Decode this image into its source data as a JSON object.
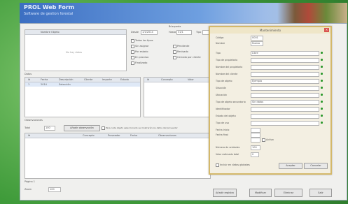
{
  "app": {
    "title": "PROL Web Form",
    "subtitle": "Software de gestion forestal"
  },
  "toolbar": {
    "search_title": "Búsqueda",
    "from_label": "Desde",
    "from_value": "1/1/2014",
    "to_label": "Hasta",
    "to_value": "31/1",
    "tipo_label": "Tipo"
  },
  "filters": {
    "options": [
      "Todos los tipos",
      "Sin asignar",
      "Por estado",
      "En proceso",
      "Finalizado"
    ],
    "options_right": [
      "Pendiente",
      "Revisado",
      "Cerrado por cliente"
    ]
  },
  "upper_list": {
    "header": "Nombre Objeto",
    "empty_text": "No hay datos"
  },
  "middle_tables": {
    "left_header": "Datos",
    "left_columns": [
      "Id",
      "Fecha",
      "Descripción",
      "Cliente",
      "Importe",
      "Estado"
    ],
    "right_columns": [
      "Id",
      "Concepto",
      "Valor"
    ],
    "left_row": [
      "1",
      "2014",
      "Selección",
      "",
      "",
      ""
    ]
  },
  "lower_section": {
    "label": "Observaciones",
    "count_label": "Total",
    "count_value": "100",
    "button_label": "Añadir observación",
    "hint": "Para cada objeto seleccionado se mostrarán los datos del proveedor",
    "columns": [
      "Id",
      "Concepto",
      "Proveedor",
      "Fecha",
      "Observaciones"
    ]
  },
  "status": {
    "left_label": "Página 1",
    "zoom_label": "Zoom",
    "zoom_value": "100"
  },
  "dialog": {
    "title": "Mantenimiento",
    "rows": [
      {
        "label": "Código",
        "value": "0001"
      },
      {
        "label": "Nombre",
        "value": "Nuevo"
      },
      {
        "label": "Tipo",
        "value": "Libre"
      },
      {
        "label": "Tipo de propietario",
        "value": ""
      },
      {
        "label": "Nombre del propietario",
        "value": ""
      },
      {
        "label": "Nombre del cliente",
        "value": ""
      },
      {
        "label": "Tipo de objeto",
        "value": "Ejemplo"
      },
      {
        "label": "Situación",
        "value": ""
      },
      {
        "label": "Ubicación",
        "value": ""
      },
      {
        "label": "Tipo de objeto secundario",
        "value": "Sin datos"
      },
      {
        "label": "Identificador",
        "value": ""
      },
      {
        "label": "Estado del objeto",
        "value": ""
      },
      {
        "label": "Tipo de uso",
        "value": ""
      },
      {
        "label": "Fecha inicio",
        "value": ""
      },
      {
        "label": "Fecha final",
        "value": ""
      }
    ],
    "extra_label": "Duración",
    "check_label": "Activo",
    "number_label": "Número de unidades",
    "number_value": "100",
    "value_label": "Valor estimado total",
    "value_value": "0",
    "bottom_check": "Incluir en datos globales",
    "accept_label": "Aceptar",
    "cancel_label": "Cancelar"
  },
  "footer": {
    "buttons": [
      "Añadir registro",
      "Modificar",
      "Eliminar",
      "Salir"
    ]
  },
  "colors": {
    "banner": "#3c6fc2",
    "dialog_border": "#d4b86a",
    "accent_green": "#2f9a2f"
  }
}
